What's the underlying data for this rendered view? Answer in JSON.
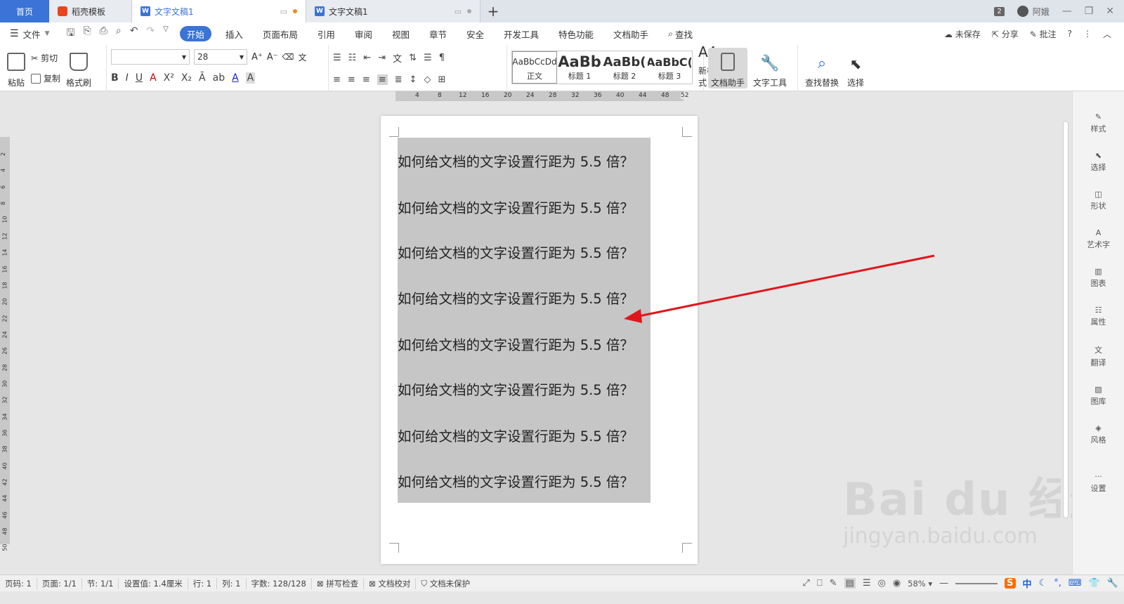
{
  "tabs": {
    "home": "首页",
    "template": "稻壳模板",
    "doc_active": "文字文稿1",
    "doc_second": "文字文稿1",
    "new_tab": "+"
  },
  "titlebar": {
    "badge": "2",
    "user": "阿娥"
  },
  "menubar": {
    "file": "文件",
    "items": [
      "开始",
      "插入",
      "页面布局",
      "引用",
      "审阅",
      "视图",
      "章节",
      "安全",
      "开发工具",
      "特色功能",
      "文档助手"
    ],
    "search": "查找",
    "unsaved": "未保存",
    "share": "分享",
    "comment": "批注"
  },
  "ribbon": {
    "paste": "粘贴",
    "cut": "剪切",
    "copy": "复制",
    "format_painter": "格式刷",
    "font_name": "",
    "font_size": "28",
    "styles": [
      {
        "preview": "AaBbCcDd",
        "label": "正文"
      },
      {
        "preview": "AaBb",
        "label": "标题 1"
      },
      {
        "preview": "AaBb(",
        "label": "标题 2"
      },
      {
        "preview": "AaBbC(",
        "label": "标题 3"
      }
    ],
    "new_style": "新样式",
    "doc_assistant": "文档助手",
    "text_tools": "文字工具",
    "find_replace": "查找替换",
    "select": "选择"
  },
  "ruler": {
    "h_ticks": [
      "4",
      "8",
      "12",
      "16",
      "20",
      "24",
      "28",
      "32",
      "36",
      "40",
      "44",
      "48",
      "52"
    ],
    "v_ticks": [
      "2",
      "4",
      "6",
      "8",
      "10",
      "12",
      "14",
      "16",
      "18",
      "20",
      "22",
      "24",
      "26",
      "28",
      "30",
      "32",
      "34",
      "36",
      "38",
      "40",
      "42",
      "44",
      "46",
      "48",
      "50"
    ]
  },
  "document": {
    "lines": [
      "如何给文档的文字设置行距为 5.5 倍？",
      "如何给文档的文字设置行距为 5.5 倍？",
      "如何给文档的文字设置行距为 5.5 倍？",
      "如何给文档的文字设置行距为 5.5 倍？",
      "如何给文档的文字设置行距为 5.5 倍？",
      "如何给文档的文字设置行距为 5.5 倍？",
      "如何给文档的文字设置行距为 5.5 倍？",
      "如何给文档的文字设置行距为 5.5 倍？"
    ]
  },
  "right_panel": [
    "样式",
    "选择",
    "形状",
    "艺术字",
    "图表",
    "属性",
    "翻译",
    "图库",
    "风格",
    "设置"
  ],
  "watermark": {
    "big": "Bai du 经验",
    "small": "jingyan.baidu.com"
  },
  "statusbar": {
    "page_num": "页码: 1",
    "pages": "页面: 1/1",
    "section": "节: 1/1",
    "setting": "设置值: 1.4厘米",
    "row": "行: 1",
    "col": "列: 1",
    "words": "字数: 128/128",
    "spell": "拼写检查",
    "proof": "文档校对",
    "protect": "文档未保护",
    "zoom": "58%"
  },
  "colors": {
    "accent": "#3b73d6",
    "selection": "#c6c6c6",
    "arrow": "#e0161c"
  }
}
